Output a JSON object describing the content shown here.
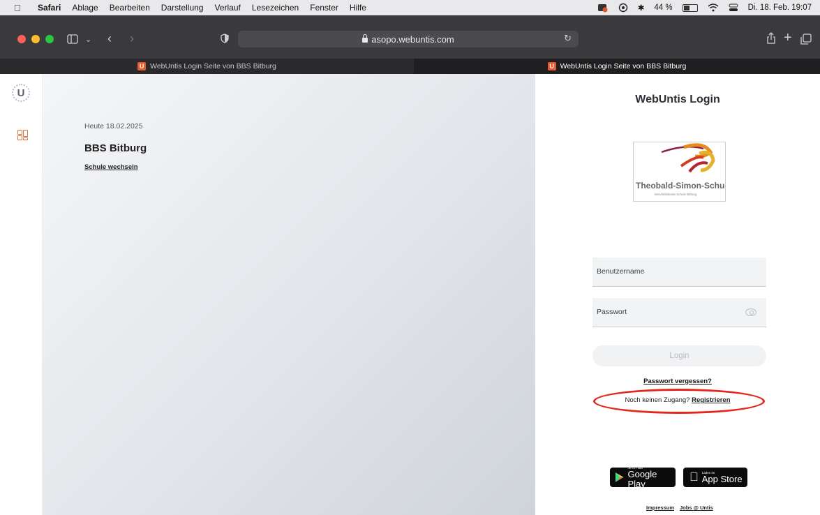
{
  "menubar": {
    "app": "Safari",
    "items": [
      "Ablage",
      "Bearbeiten",
      "Darstellung",
      "Verlauf",
      "Lesezeichen",
      "Fenster",
      "Hilfe"
    ],
    "battery_percent": "44 %",
    "battery_level": 0.44,
    "datetime": "Di. 18. Feb. 19:07"
  },
  "browser": {
    "address": "asopo.webuntis.com",
    "tabs": [
      {
        "title": "WebUntis Login Seite von BBS Bitburg",
        "active": false
      },
      {
        "title": "WebUntis Login Seite von BBS Bitburg",
        "active": true
      }
    ],
    "favicon_letter": "U"
  },
  "sidebar": {
    "logo_letter": "U",
    "icons": [
      "untis-logo-icon",
      "dashboard-grid-icon"
    ]
  },
  "main": {
    "date": "Heute 18.02.2025",
    "school": "BBS Bitburg",
    "change_school": "Schule wechseln"
  },
  "login": {
    "title": "WebUntis Login",
    "school_logo": {
      "name": "Theobald-Simon-Schule",
      "subtitle": "Berufsbildende Schule Bitburg"
    },
    "username_placeholder": "Benutzername",
    "password_placeholder": "Passwort",
    "login_button": "Login",
    "forgot_password": "Passwort vergessen?",
    "no_access": "Noch keinen Zugang?",
    "register": "Registrieren",
    "google_play": {
      "small": "JETZT BEI",
      "big": "Google Play"
    },
    "app_store": {
      "small": "Laden im",
      "big": "App Store"
    },
    "footer_links": [
      "Impressum",
      "Jobs @ Untis"
    ]
  },
  "colors": {
    "accent": "#e85a2c",
    "annotation": "#e5261b",
    "toolbar": "#3a3a3c"
  }
}
